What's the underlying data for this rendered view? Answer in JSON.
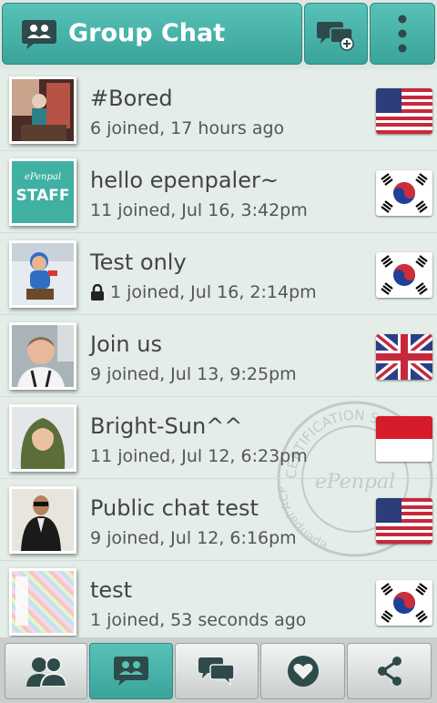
{
  "header": {
    "title": "Group Chat",
    "title_icon": "group-chat-icon",
    "new_chat_icon": "new-chat-icon",
    "menu_icon": "overflow-menu-icon"
  },
  "avatars": {
    "staff_small_text": "ePenpal",
    "staff_text": "STAFF"
  },
  "chats": [
    {
      "name": "#Bored",
      "meta": "6 joined, 17 hours ago",
      "flag": "us",
      "locked": false
    },
    {
      "name": "hello epenpaler~",
      "meta": "11 joined, Jul 16, 3:42pm",
      "flag": "kr",
      "locked": false
    },
    {
      "name": "Test only",
      "meta": "1 joined, Jul 16, 2:14pm",
      "flag": "kr",
      "locked": true
    },
    {
      "name": "Join us",
      "meta": "9 joined, Jul 13, 9:25pm",
      "flag": "uk",
      "locked": false
    },
    {
      "name": "Bright-Sun^^",
      "meta": "11 joined, Jul 12, 6:23pm",
      "flag": "id",
      "locked": false
    },
    {
      "name": "Public chat test",
      "meta": "9 joined, Jul 12, 6:16pm",
      "flag": "us",
      "locked": false
    },
    {
      "name": "test",
      "meta": "1 joined, 53 seconds ago",
      "flag": "kr",
      "locked": false
    }
  ],
  "watermark": {
    "text_top": "CERTIFICATION ST",
    "text_center": "ePenpal",
    "text_left": "epenpal ACP"
  },
  "tabs": [
    {
      "icon": "friends-icon",
      "active": false
    },
    {
      "icon": "group-chat-icon",
      "active": true
    },
    {
      "icon": "messages-icon",
      "active": false
    },
    {
      "icon": "favorites-heart-icon",
      "active": false
    },
    {
      "icon": "share-icon",
      "active": false
    }
  ],
  "colors": {
    "accent": "#46b1a7",
    "list_bg": "#e4ede8"
  }
}
